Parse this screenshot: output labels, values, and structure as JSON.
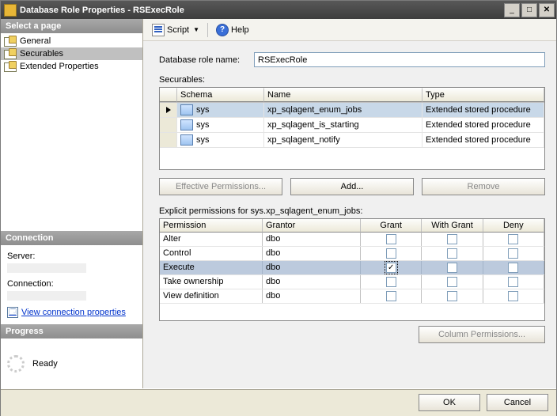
{
  "window": {
    "title": "Database Role Properties - RSExecRole"
  },
  "left": {
    "selectPageHeader": "Select a page",
    "pages": [
      {
        "label": "General",
        "selected": false
      },
      {
        "label": "Securables",
        "selected": true
      },
      {
        "label": "Extended Properties",
        "selected": false
      }
    ],
    "connectionHeader": "Connection",
    "serverLabel": "Server:",
    "connectionLabel": "Connection:",
    "viewConnProps": "View connection properties",
    "progressHeader": "Progress",
    "progressStatus": "Ready"
  },
  "toolbar": {
    "script": "Script",
    "help": "Help"
  },
  "main": {
    "roleNameLabel": "Database role name:",
    "roleName": "RSExecRole",
    "securablesLabel": "Securables:",
    "securablesHeaders": {
      "schema": "Schema",
      "name": "Name",
      "type": "Type"
    },
    "securables": [
      {
        "schema": "sys",
        "name": "xp_sqlagent_enum_jobs",
        "type": "Extended stored procedure",
        "selected": true
      },
      {
        "schema": "sys",
        "name": "xp_sqlagent_is_starting",
        "type": "Extended stored procedure",
        "selected": false
      },
      {
        "schema": "sys",
        "name": "xp_sqlagent_notify",
        "type": "Extended stored procedure",
        "selected": false
      }
    ],
    "effectivePerms": "Effective Permissions...",
    "add": "Add...",
    "remove": "Remove",
    "explicitLabel": "Explicit permissions for sys.xp_sqlagent_enum_jobs:",
    "permHeaders": {
      "permission": "Permission",
      "grantor": "Grantor",
      "grant": "Grant",
      "withGrant": "With Grant",
      "deny": "Deny"
    },
    "permissions": [
      {
        "permission": "Alter",
        "grantor": "dbo",
        "grant": false,
        "withGrant": false,
        "deny": false,
        "selected": false
      },
      {
        "permission": "Control",
        "grantor": "dbo",
        "grant": false,
        "withGrant": false,
        "deny": false,
        "selected": false
      },
      {
        "permission": "Execute",
        "grantor": "dbo",
        "grant": true,
        "withGrant": false,
        "deny": false,
        "selected": true,
        "focus": true
      },
      {
        "permission": "Take ownership",
        "grantor": "dbo",
        "grant": false,
        "withGrant": false,
        "deny": false,
        "selected": false
      },
      {
        "permission": "View definition",
        "grantor": "dbo",
        "grant": false,
        "withGrant": false,
        "deny": false,
        "selected": false
      }
    ],
    "columnPerms": "Column Permissions..."
  },
  "footer": {
    "ok": "OK",
    "cancel": "Cancel"
  }
}
